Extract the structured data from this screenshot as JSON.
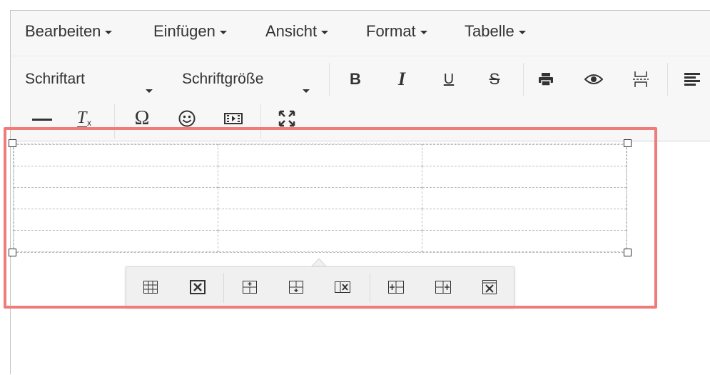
{
  "menubar": {
    "items": [
      {
        "label": "Bearbeiten"
      },
      {
        "label": "Einfügen"
      },
      {
        "label": "Ansicht"
      },
      {
        "label": "Format"
      },
      {
        "label": "Tabelle"
      }
    ]
  },
  "toolbar": {
    "font_family": "Schriftart",
    "font_size": "Schriftgröße",
    "bold_icon": "bold-icon",
    "italic_icon": "italic-icon",
    "underline_icon": "underline-icon",
    "strikethrough_icon": "strikethrough-icon",
    "print_icon": "print-icon",
    "preview_icon": "eye-icon",
    "pagebreak_icon": "page-break-icon",
    "align_icon": "align-left-icon",
    "hr_icon": "horizontal-rule-icon",
    "clear_format_icon": "clear-formatting-icon",
    "charmap_icon": "omega-icon",
    "emoticons_icon": "smiley-icon",
    "media_icon": "media-icon",
    "fullscreen_icon": "fullscreen-icon"
  },
  "table": {
    "rows": 5,
    "cols": 3
  },
  "context_toolbar": {
    "buttons": [
      "table-properties-icon",
      "delete-table-icon",
      "insert-row-before-icon",
      "insert-row-after-icon",
      "delete-row-icon",
      "insert-column-before-icon",
      "insert-column-after-icon",
      "delete-column-icon"
    ]
  },
  "colors": {
    "highlight": "#f07b7b",
    "toolbar_bg": "#f7f7f7",
    "icon": "#333333"
  }
}
